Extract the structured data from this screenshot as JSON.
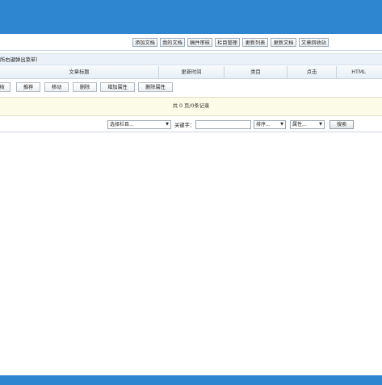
{
  "toolbar": {
    "buttons": [
      "添加文档",
      "我的文档",
      "稿件审核",
      "栏目管理",
      "更新列表",
      "更新文档",
      "文章回收站"
    ]
  },
  "hint": "所右键弹出菜单）",
  "table_header": {
    "columns": [
      "文章标题",
      "更新时间",
      "类目",
      "点击",
      "HTML"
    ]
  },
  "actions": [
    "审核",
    "推荐",
    "移动",
    "删除",
    "增加属性",
    "删除属性"
  ],
  "pagination": "共 0 页/0条记录",
  "search": {
    "column_select": "选择栏目...",
    "keyword_label": "关键字：",
    "keyword_value": "",
    "order_select": "排序...",
    "attr_select": "属性...",
    "submit": "搜索"
  },
  "colors": {
    "topbar": "#2f86d0",
    "header_bg": "#e6eef6",
    "pager_bg": "#fbfbe8"
  }
}
